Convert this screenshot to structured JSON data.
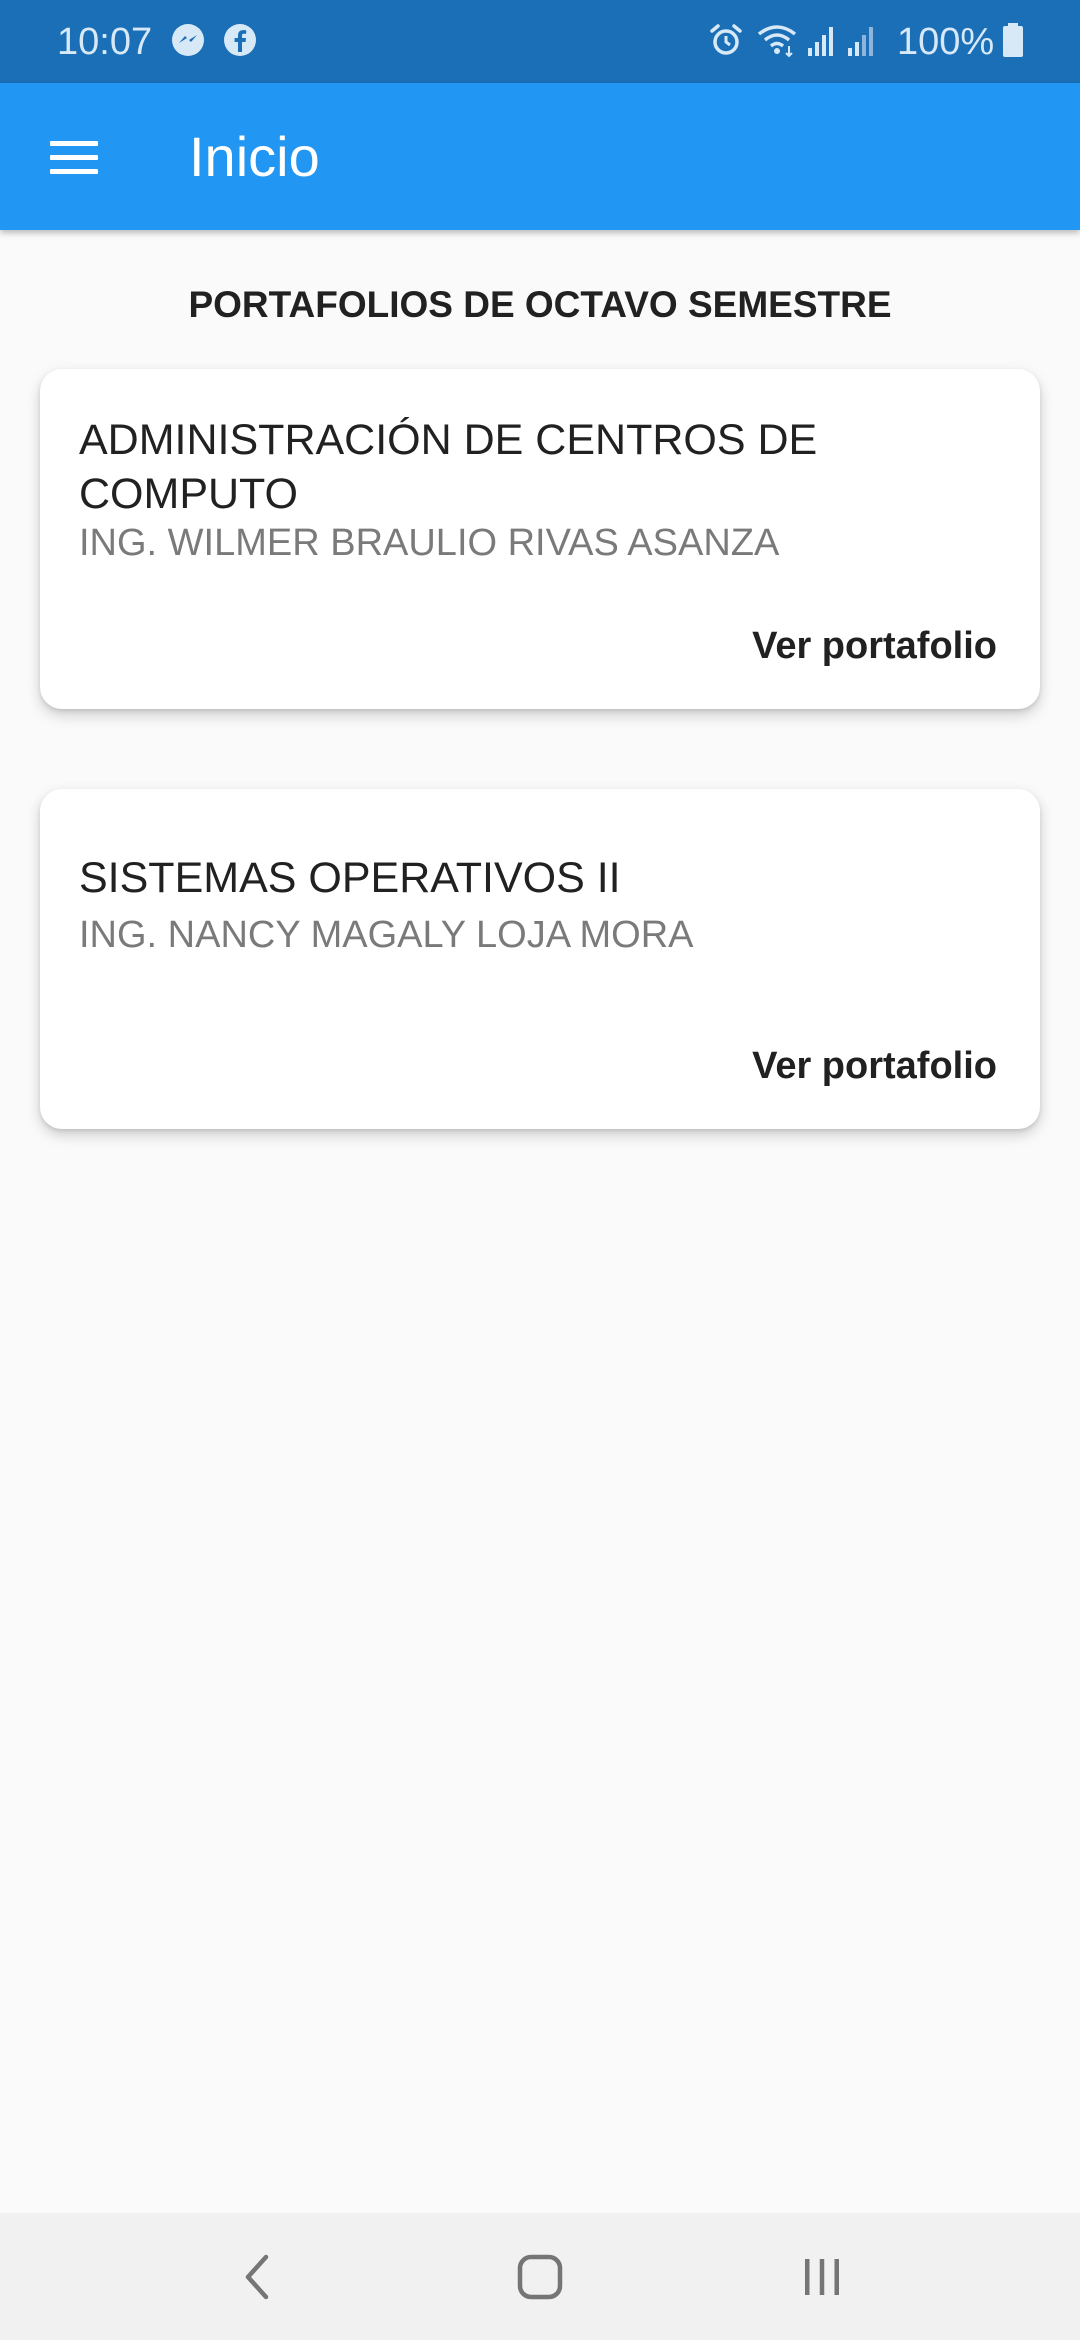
{
  "status_bar": {
    "time": "10:07",
    "battery": "100%",
    "icons": [
      "messenger-icon",
      "facebook-icon",
      "alarm-icon",
      "wifi-icon",
      "signal-icon",
      "signal-icon",
      "battery-icon"
    ]
  },
  "app_bar": {
    "title": "Inicio",
    "menu_icon": "menu-icon"
  },
  "main": {
    "section_title": "PORTAFOLIOS DE OCTAVO SEMESTRE",
    "cards": [
      {
        "title": "ADMINISTRACIÓN DE CENTROS DE COMPUTO",
        "subtitle": "ING. WILMER BRAULIO RIVAS ASANZA",
        "action_label": "Ver portafolio"
      },
      {
        "title": "SISTEMAS OPERATIVOS II",
        "subtitle": "ING. NANCY MAGALY LOJA MORA",
        "action_label": "Ver portafolio"
      }
    ]
  },
  "nav_bar": {
    "back_icon": "back-icon",
    "home_icon": "home-icon",
    "recents_icon": "recents-icon"
  },
  "colors": {
    "status_bar": "#1a6fb6",
    "app_bar": "#2196f3",
    "background": "#fafafa",
    "card": "#ffffff",
    "subtitle_text": "#7a7a7a"
  }
}
